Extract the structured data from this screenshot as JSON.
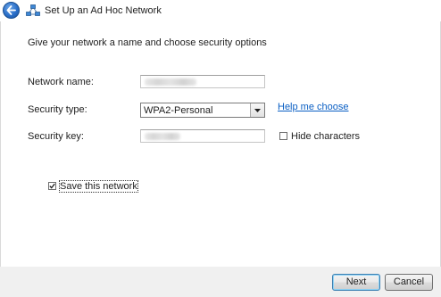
{
  "titlebar": {
    "title": "Set Up an Ad Hoc Network"
  },
  "main": {
    "heading": "Give your network a name and choose security options",
    "fields": {
      "network_name_label": "Network name:",
      "security_type_label": "Security type:",
      "security_type_value": "WPA2-Personal",
      "security_key_label": "Security key:"
    },
    "help_link": "Help me choose",
    "hide_characters": {
      "label": "Hide characters",
      "checked": false
    },
    "save_network": {
      "label": "Save this network",
      "checked": true
    }
  },
  "footer": {
    "next_label": "Next",
    "cancel_label": "Cancel"
  },
  "colors": {
    "link": "#0a5fc4",
    "footer_bg": "#f0f0f0",
    "back_button": "#2a6fc9"
  },
  "icons": [
    "back-arrow-icon",
    "network-icon",
    "dropdown-arrow-icon",
    "checkmark-icon"
  ]
}
